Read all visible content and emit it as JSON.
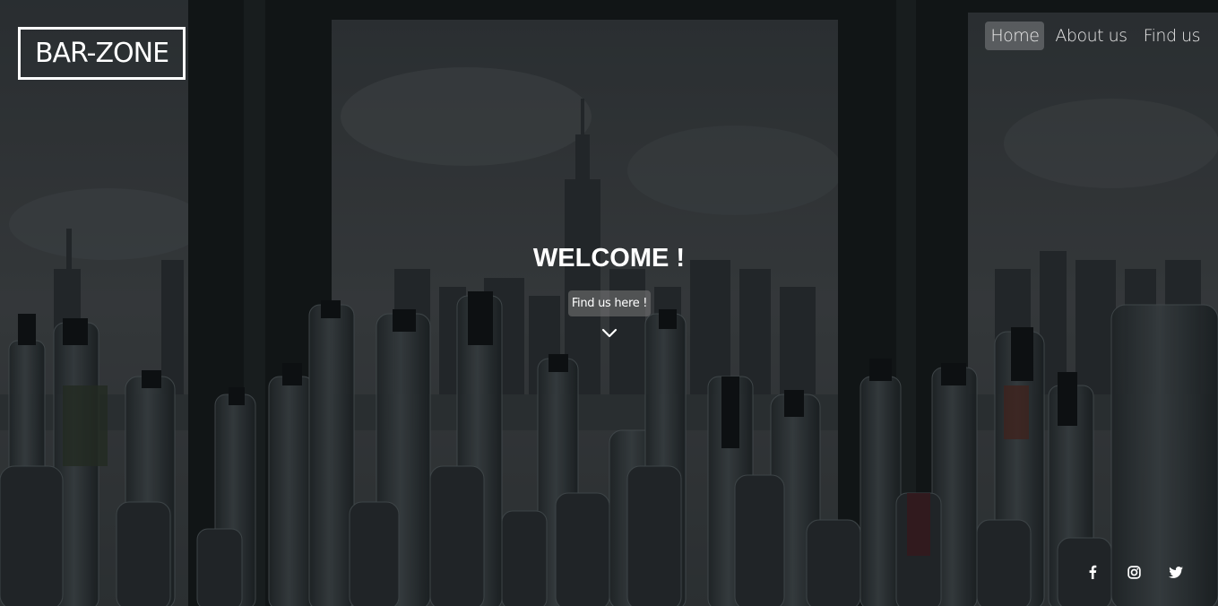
{
  "header": {
    "logo": "BAR-ZONE",
    "nav": [
      {
        "label": "Home",
        "active": true
      },
      {
        "label": "About us",
        "active": false
      },
      {
        "label": "Find us",
        "active": false
      }
    ]
  },
  "hero": {
    "title": "WELCOME !",
    "cta_label": "Find us here !",
    "scroll_icon": "chevron-down-icon"
  },
  "social": [
    {
      "icon": "facebook-icon"
    },
    {
      "icon": "instagram-icon"
    },
    {
      "icon": "twitter-icon"
    }
  ],
  "colors": {
    "text": "#ffffff",
    "overlay": "#1d2224"
  }
}
